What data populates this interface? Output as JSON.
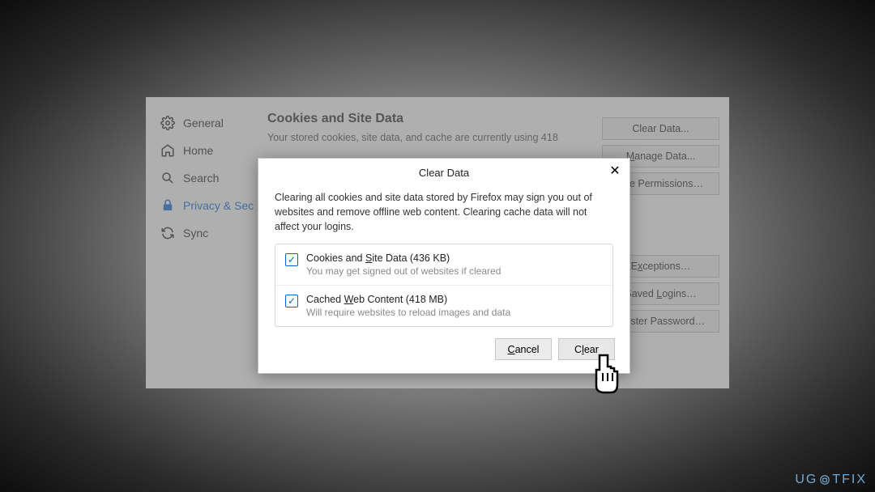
{
  "sidebar": {
    "items": [
      {
        "label": "General"
      },
      {
        "label": "Home"
      },
      {
        "label": "Search"
      },
      {
        "label": "Privacy & Sec"
      },
      {
        "label": "Sync"
      }
    ]
  },
  "content": {
    "heading": "Cookies and Site Data",
    "description": "Your stored cookies, site data, and cache are currently using 418",
    "buttons_top": [
      "Clear Data...",
      "Manage Data...",
      "age Permissions…"
    ],
    "buttons_bottom": [
      "Exceptions…",
      "Saved Logins…",
      "Master Password…"
    ]
  },
  "dialog": {
    "title": "Clear Data",
    "close": "✕",
    "body": "Clearing all cookies and site data stored by Firefox may sign you out of websites and remove offline web content. Clearing cache data will not affect your logins.",
    "options": [
      {
        "label_pre": "Cookies and ",
        "label_u": "S",
        "label_post": "ite Data (436 KB)",
        "sub": "You may get signed out of websites if cleared"
      },
      {
        "label_pre": "Cached ",
        "label_u": "W",
        "label_post": "eb Content (418 MB)",
        "sub": "Will require websites to reload images and data"
      }
    ],
    "cancel_pre": "",
    "cancel_u": "C",
    "cancel_post": "ancel",
    "clear_pre": "C",
    "clear_u": "l",
    "clear_post": "ear"
  },
  "watermark": "UG  TFIX"
}
